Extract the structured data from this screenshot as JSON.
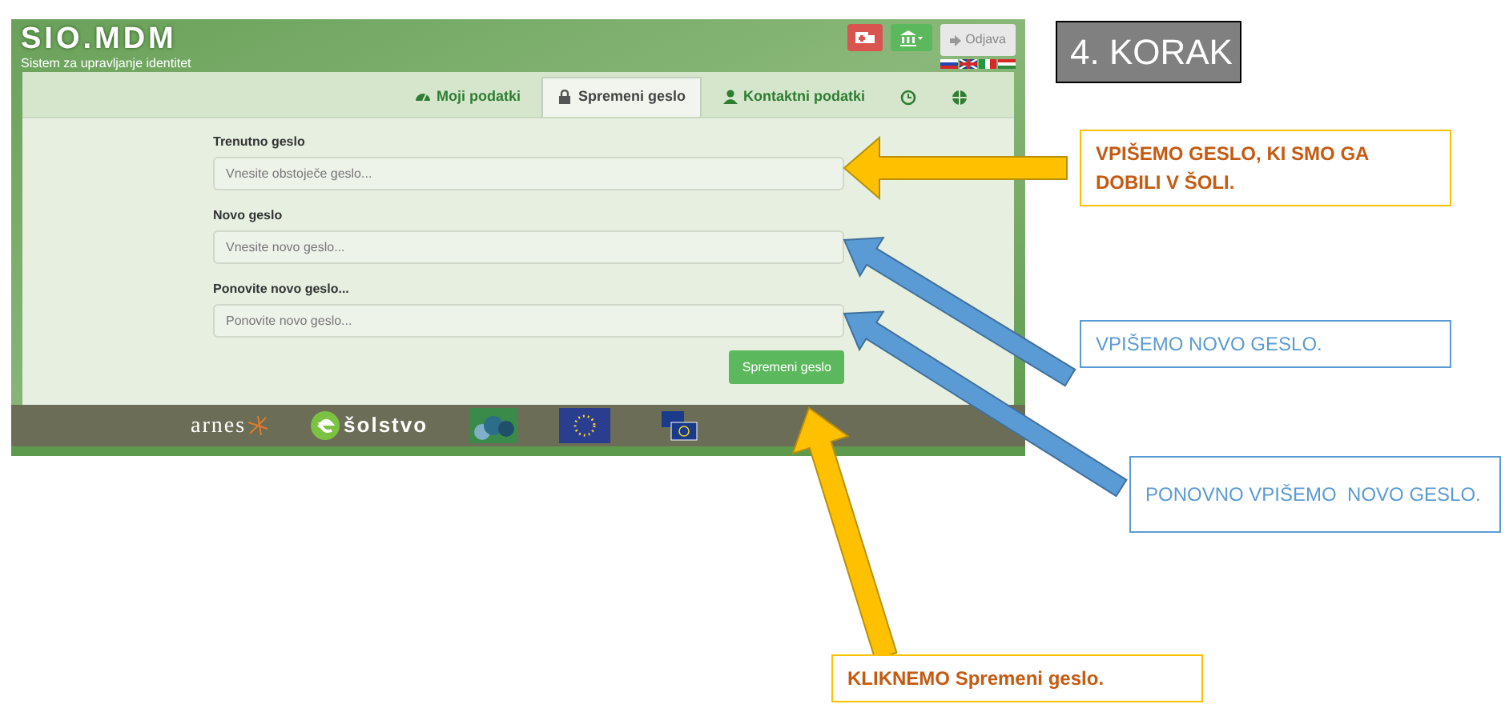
{
  "app": {
    "logo": "SIO.MDM",
    "subtitle": "Sistem za upravljanje identitet",
    "logout": "Odjava",
    "tabs": [
      {
        "label": "Moji podatki",
        "kind": "dashboard",
        "selected": false
      },
      {
        "label": "Spremeni geslo",
        "kind": "lock",
        "selected": true
      },
      {
        "label": "Kontaktni podatki",
        "kind": "user",
        "selected": false
      },
      {
        "kind": "clock",
        "selected": false
      },
      {
        "kind": "globe",
        "selected": false
      }
    ],
    "fields": [
      {
        "label": "Trenutno geslo",
        "placeholder": "Vnesite obstoječe geslo..."
      },
      {
        "label": "Novo geslo",
        "placeholder": "Vnesite novo geslo..."
      },
      {
        "label": "Ponovite novo geslo...",
        "placeholder": "Ponovite novo geslo..."
      }
    ],
    "submit": "Spremeni geslo",
    "footer": [
      "arnes",
      "šolstvo"
    ]
  },
  "step": "4. KORAK",
  "callouts": [
    {
      "text": "VPIŠEMO GESLO, KI SMO GA DOBILI V ŠOLI.",
      "color": "#c55a11"
    },
    {
      "text": "VPIŠEMO NOVO GESLO.",
      "color": "#5b9bd5"
    },
    {
      "text": "PONOVNO VPIŠEMO  NOVO GESLO.",
      "color": "#5b9bd5"
    },
    {
      "text": "KLIKNEMO Spremeni geslo.",
      "color": "#c55a11"
    }
  ]
}
